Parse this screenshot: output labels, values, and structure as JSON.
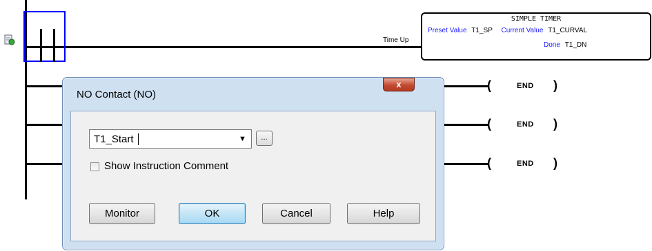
{
  "ladder": {
    "output_label": "Time Up",
    "timer": {
      "title": "SIMPLE TIMER",
      "preset_label": "Preset Value",
      "preset_value": "T1_SP",
      "current_label": "Current Value",
      "current_value": "T1_CURVAL",
      "done_label": "Done",
      "done_value": "T1_DN"
    },
    "coils": [
      {
        "text": "END"
      },
      {
        "text": "END"
      },
      {
        "text": "END"
      }
    ]
  },
  "dialog": {
    "title": "NO Contact (NO)",
    "close_glyph": "x",
    "tag_value": "T1_Start",
    "ellipsis": "...",
    "show_comment_label": "Show Instruction Comment",
    "show_comment_checked": false,
    "buttons": {
      "monitor": "Monitor",
      "ok": "OK",
      "cancel": "Cancel",
      "help": "Help"
    }
  }
}
